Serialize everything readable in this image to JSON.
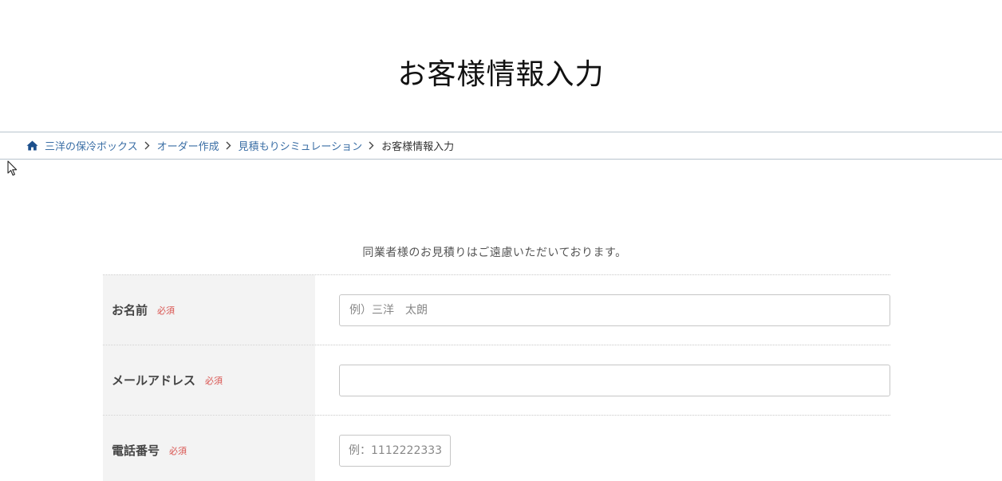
{
  "page": {
    "title": "お客様情報入力"
  },
  "breadcrumb": {
    "items": [
      {
        "label": "三洋の保冷ボックス"
      },
      {
        "label": "オーダー作成"
      },
      {
        "label": "見積もりシミュレーション"
      }
    ],
    "current": "お客様情報入力"
  },
  "notice": "同業者様のお見積りはご遠慮いただいております。",
  "form": {
    "required_label": "必須",
    "fields": [
      {
        "label": "お名前",
        "value": "",
        "placeholder": "例）三洋　太朗"
      },
      {
        "label": "メールアドレス",
        "value": "",
        "placeholder": ""
      },
      {
        "label": "電話番号",
        "value": "",
        "placeholder": "例：1112222333"
      }
    ]
  },
  "colors": {
    "link": "#3a6ea5",
    "required": "#d9534f",
    "label_bg": "#f3f3f3"
  }
}
